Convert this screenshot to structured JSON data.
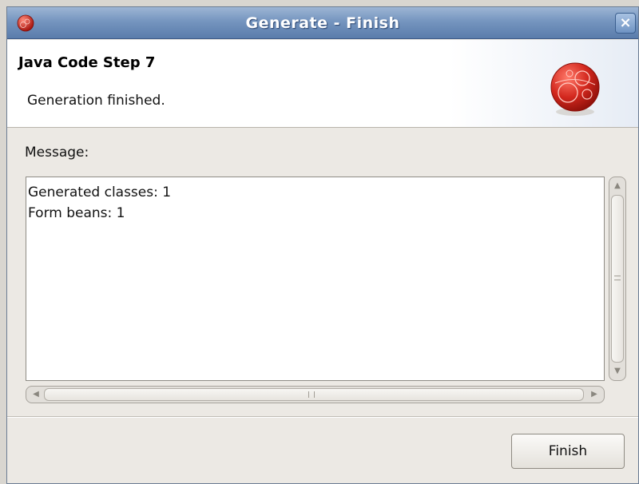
{
  "window": {
    "title": "Generate - Finish",
    "close_label": "×"
  },
  "banner": {
    "title": "Java Code Step 7",
    "description": "Generation finished."
  },
  "message": {
    "label": "Message:",
    "text": "Generated classes: 1\nForm beans: 1"
  },
  "buttons": {
    "finish": "Finish"
  },
  "icons": {
    "title": "app-logo-icon",
    "banner": "globe-logo-icon"
  },
  "colors": {
    "titlebar": "#7595bf",
    "logo": "#c7261f"
  }
}
